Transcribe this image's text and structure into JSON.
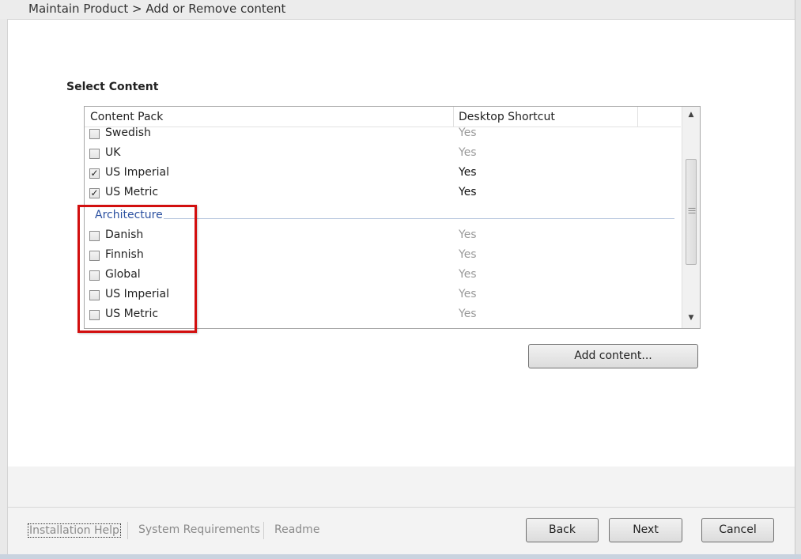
{
  "breadcrumb": "Maintain Product > Add or Remove content",
  "section_title": "Select Content",
  "list": {
    "columns": [
      "Content Pack",
      "Desktop Shortcut"
    ],
    "rows": [
      {
        "name": "Swedish",
        "checked": false,
        "shortcut": "Yes"
      },
      {
        "name": "UK",
        "checked": false,
        "shortcut": "Yes"
      },
      {
        "name": "US Imperial",
        "checked": true,
        "shortcut": "Yes"
      },
      {
        "name": "US Metric",
        "checked": true,
        "shortcut": "Yes"
      }
    ],
    "group": {
      "title": "Architecture",
      "rows": [
        {
          "name": "Danish",
          "checked": false,
          "shortcut": "Yes"
        },
        {
          "name": "Finnish",
          "checked": false,
          "shortcut": "Yes"
        },
        {
          "name": "Global",
          "checked": false,
          "shortcut": "Yes"
        },
        {
          "name": "US Imperial",
          "checked": false,
          "shortcut": "Yes"
        },
        {
          "name": "US Metric",
          "checked": false,
          "shortcut": "Yes"
        }
      ]
    }
  },
  "check_glyph": "✓",
  "add_content_label": "Add content...",
  "footer_links": [
    "Installation Help",
    "System Requirements",
    "Readme"
  ],
  "buttons": {
    "back": "Back",
    "next": "Next",
    "cancel": "Cancel"
  },
  "colors": {
    "highlight_border": "#d20f0f",
    "group_title": "#2b50a0",
    "dim_text": "#9a9a9a"
  }
}
